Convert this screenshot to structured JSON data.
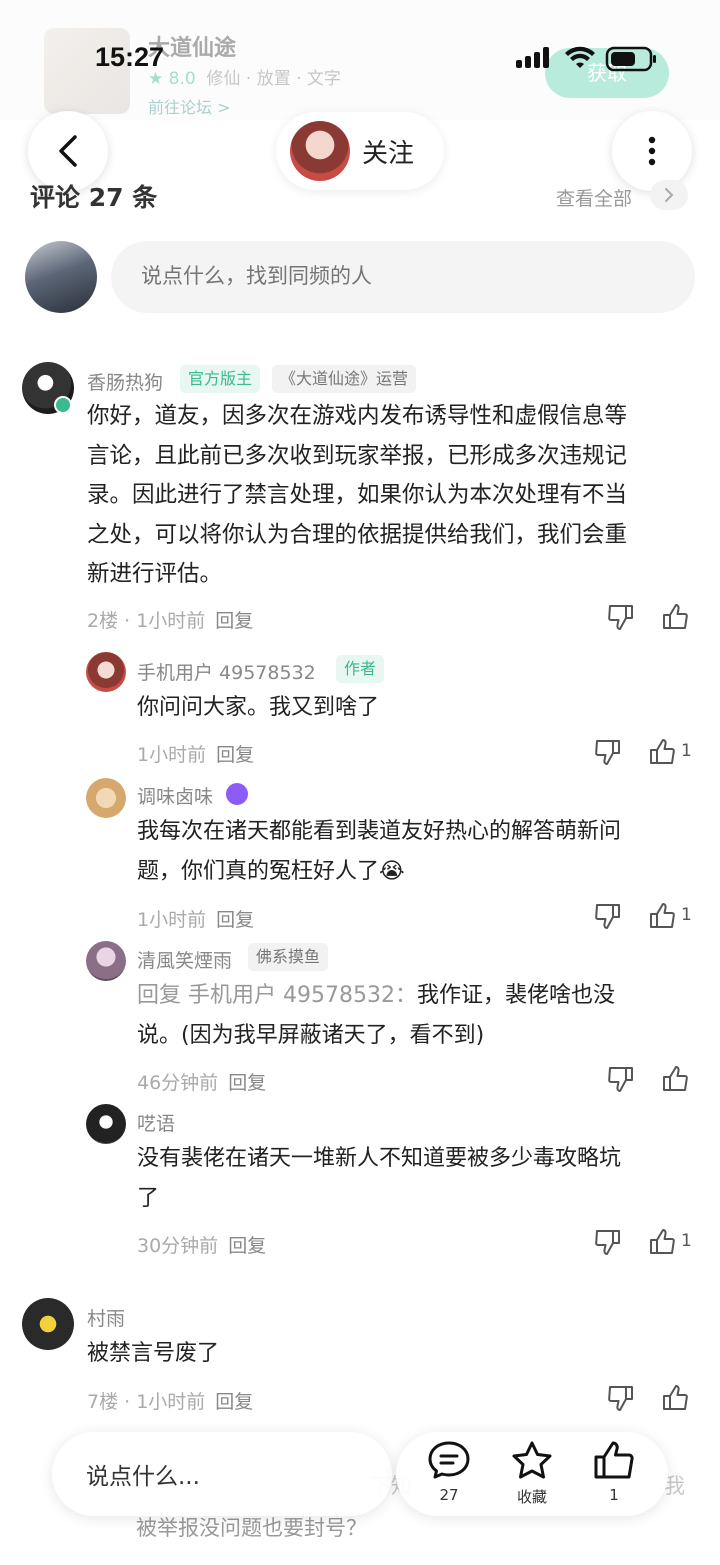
{
  "game_card": {
    "title": "大道仙途",
    "rating": "★ 8.0",
    "tags": "修仙 · 放置 · 文字",
    "forum_link": "前往论坛 >",
    "get_button": "获取"
  },
  "status_bar": {
    "time": "15:27"
  },
  "nav": {
    "follow_label": "关注"
  },
  "comments_header": {
    "title": "评论 27 条",
    "view_all": "查看全部"
  },
  "input": {
    "placeholder": "说点什么，找到同频的人"
  },
  "main_comment": {
    "user": "香肠热狗",
    "badge_official": "官方版主",
    "badge_role": "《大道仙途》运营",
    "lines": [
      "你好，道友，因多次在游戏内发布诱导性和虚假信息等",
      "言论，且此前已多次收到玩家举报，已形成多次违规记",
      "录。因此进行了禁言处理，如果你认为本次处理有不当",
      "之处，可以将你认为合理的依据提供给我们，我们会重",
      "新进行评估。"
    ],
    "meta": "2楼 · 1小时前",
    "reply_label": "回复"
  },
  "replies": [
    {
      "user": "手机用户 49578532",
      "badge": "作者",
      "lines": [
        "你问问大家。我又到啥了"
      ],
      "meta": "1小时前",
      "reply_label": "回复",
      "likes": "1"
    },
    {
      "user": "调味卤味",
      "lines": [
        "我每次在诸天都能看到裴道友好热心的解答萌新问",
        "题，你们真的冤枉好人了😭"
      ],
      "meta": "1小时前",
      "reply_label": "回复",
      "likes": "1"
    },
    {
      "user": "清風笑煙雨",
      "badge": "佛系摸鱼",
      "reply_to": "回复 手机用户 49578532：",
      "lines": [
        "我作证，裴佬啥也没",
        "说。(因为我早屏蔽诸天了，看不到)"
      ],
      "meta": "46分钟前",
      "reply_label": "回复",
      "likes": ""
    },
    {
      "user": "呓语",
      "lines": [
        "没有裴佬在诸天一堆新人不知道要被多少毒攻略坑",
        "了"
      ],
      "meta": "30分钟前",
      "reply_label": "回复",
      "likes": "1"
    }
  ],
  "second_comment": {
    "user": "村雨",
    "lines": [
      "被禁言号废了"
    ],
    "meta": "7楼 · 1小时前",
    "reply_label": "回复"
  },
  "partial_comment": {
    "faded_text": "下知",
    "faded_text_2": "我",
    "text": "被举报没问题也要封号？"
  },
  "bottom_bar": {
    "say_placeholder": "说点什么...",
    "comment_count": "27",
    "favorite_label": "收藏",
    "like_count": "1"
  }
}
